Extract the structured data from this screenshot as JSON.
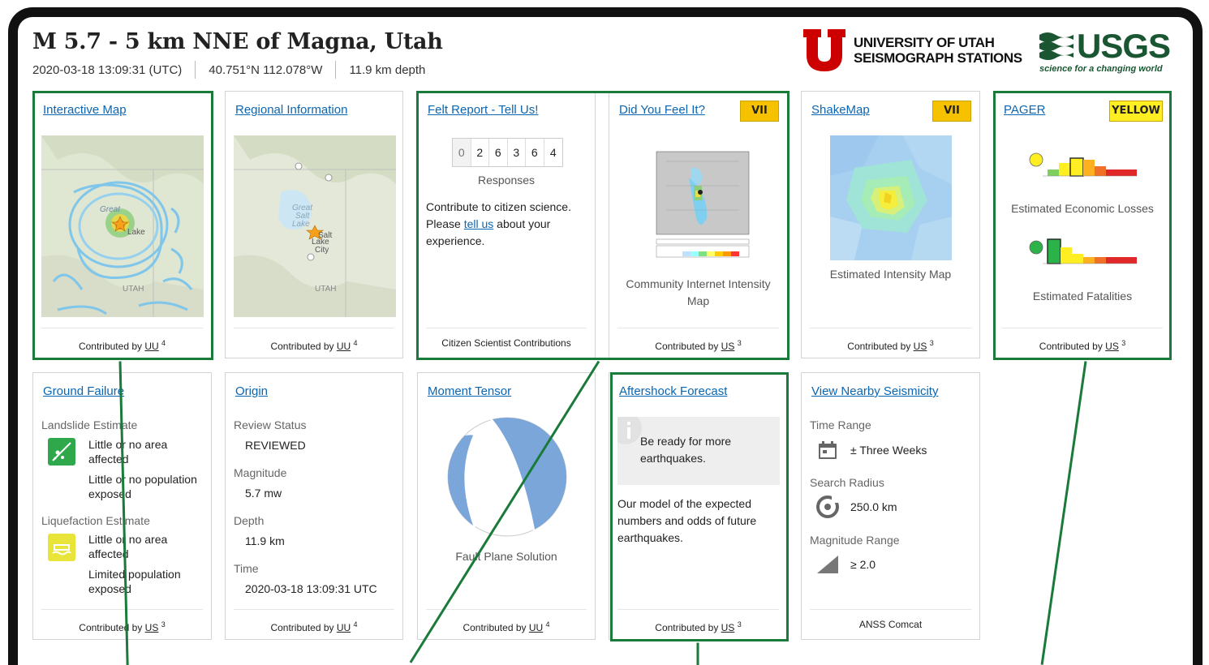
{
  "header": {
    "title": "M 5.7 - 5 km NNE of Magna, Utah",
    "time": "2020-03-18 13:09:31 (UTC)",
    "location": "40.751°N 112.078°W",
    "depth": "11.9 km depth"
  },
  "logos": {
    "uu_line1": "UNIVERSITY OF UTAH",
    "uu_line2": "SEISMOGRAPH STATIONS",
    "usgs_word": "USGS",
    "usgs_tag": "science for a changing world"
  },
  "cards": {
    "interactive_map": {
      "title": "Interactive Map",
      "footer_prefix": "Contributed by ",
      "footer_src": "UU",
      "footer_n": "4",
      "map_labels": [
        "Great",
        "Salt",
        "Lake",
        "UTAH"
      ]
    },
    "regional": {
      "title": "Regional Information",
      "footer_prefix": "Contributed by ",
      "footer_src": "UU",
      "footer_n": "4",
      "map_labels": [
        "Great",
        "Salt",
        "Lake",
        "Salt",
        "Lake",
        "City",
        "UTAH"
      ]
    },
    "felt": {
      "title": "Felt Report - Tell Us!",
      "digits": [
        "0",
        "2",
        "6",
        "3",
        "6",
        "4"
      ],
      "responses": "Responses",
      "text1": "Contribute to citizen science.",
      "text2a": "Please ",
      "text2_link": "tell us",
      "text2b": " about your",
      "text3": "experience.",
      "footer": "Citizen Scientist Contributions"
    },
    "dyfi": {
      "title": "Did You Feel It?",
      "badge": "VII",
      "caption1": "Community Internet Intensity",
      "caption2": "Map",
      "footer_prefix": "Contributed by ",
      "footer_src": "US",
      "footer_n": "3"
    },
    "shakemap": {
      "title": "ShakeMap",
      "badge": "VII",
      "caption": "Estimated Intensity Map",
      "footer_prefix": "Contributed by ",
      "footer_src": "US",
      "footer_n": "3"
    },
    "pager": {
      "title": "PAGER",
      "badge": "YELLOW",
      "caption1": "Estimated Economic Losses",
      "caption2": "Estimated Fatalities",
      "footer_prefix": "Contributed by ",
      "footer_src": "US",
      "footer_n": "3"
    },
    "ground_failure": {
      "title": "Ground Failure",
      "landslide_label": "Landslide Estimate",
      "ls_area1": "Little or no area",
      "ls_area2": "affected",
      "ls_pop1": "Little or no population",
      "ls_pop2": "exposed",
      "liq_label": "Liquefaction Estimate",
      "lq_area1": "Little or no area",
      "lq_area2": "affected",
      "lq_pop1": "Limited population",
      "lq_pop2": "exposed",
      "footer_prefix": "Contributed by ",
      "footer_src": "US",
      "footer_n": "3"
    },
    "origin": {
      "title": "Origin",
      "review_label": "Review Status",
      "review_value": "REVIEWED",
      "mag_label": "Magnitude",
      "mag_value": "5.7 mw",
      "depth_label": "Depth",
      "depth_value": "11.9 km",
      "time_label": "Time",
      "time_value": "2020-03-18 13:09:31 UTC",
      "footer_prefix": "Contributed by ",
      "footer_src": "UU",
      "footer_n": "4"
    },
    "moment_tensor": {
      "title": "Moment Tensor",
      "caption": "Fault Plane Solution",
      "footer_prefix": "Contributed by ",
      "footer_src": "UU",
      "footer_n": "4"
    },
    "aftershock": {
      "title": "Aftershock Forecast",
      "alert1": "Be ready for more",
      "alert2": "earthquakes.",
      "text1": "Our model of the expected",
      "text2": "numbers and odds of future",
      "text3": "earthquakes.",
      "footer_prefix": "Contributed by ",
      "footer_src": "US",
      "footer_n": "3"
    },
    "seismicity": {
      "title": "View Nearby Seismicity",
      "time_label": "Time Range",
      "time_value": "± Three Weeks",
      "radius_label": "Search Radius",
      "radius_value": "250.0 km",
      "mag_label": "Magnitude Range",
      "mag_value": "≥ 2.0",
      "footer": "ANSS Comcat"
    }
  },
  "colors": {
    "link": "#0a66b3",
    "highlight": "#1a7a3a",
    "badge_vii": "#f6c200",
    "badge_yellow": "#ffee22"
  }
}
